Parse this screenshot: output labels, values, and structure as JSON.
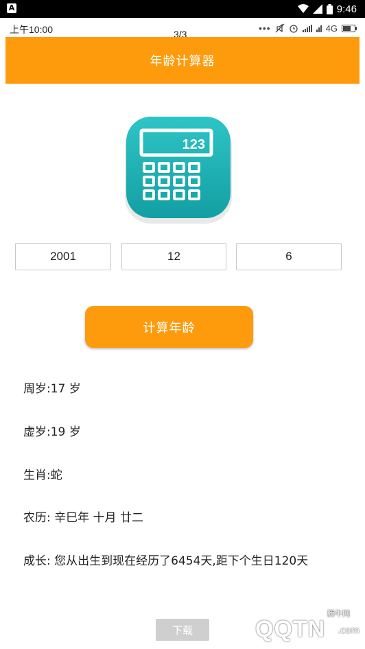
{
  "device_status": {
    "left_badge": "A",
    "time": "9:46"
  },
  "inner_status": {
    "time": "上午10:00",
    "pager": "3/3",
    "network": "4G"
  },
  "header": {
    "title": "年龄计算器"
  },
  "logo": {
    "screen_text": "123",
    "icon": "calculator-icon",
    "color": "#1fb5b8"
  },
  "inputs": {
    "year": "2001",
    "month": "12",
    "day": "6"
  },
  "calc_button": {
    "label": "计算年龄"
  },
  "results": {
    "full_age": "周岁:17 岁",
    "nominal_age": "虚岁:19 岁",
    "zodiac": "生肖:蛇",
    "lunar": "农历: 辛巳年 十月 廿二",
    "growth": "成长: 您从出生到现在经历了6454天,距下个生日120天"
  },
  "download_button": {
    "label": "下载"
  },
  "watermark": {
    "text": "QQTN",
    "suffix": ".com",
    "top_text": "腾牛网"
  },
  "colors": {
    "accent": "#fe9b0d",
    "button_disabled": "#cfcfcf"
  }
}
